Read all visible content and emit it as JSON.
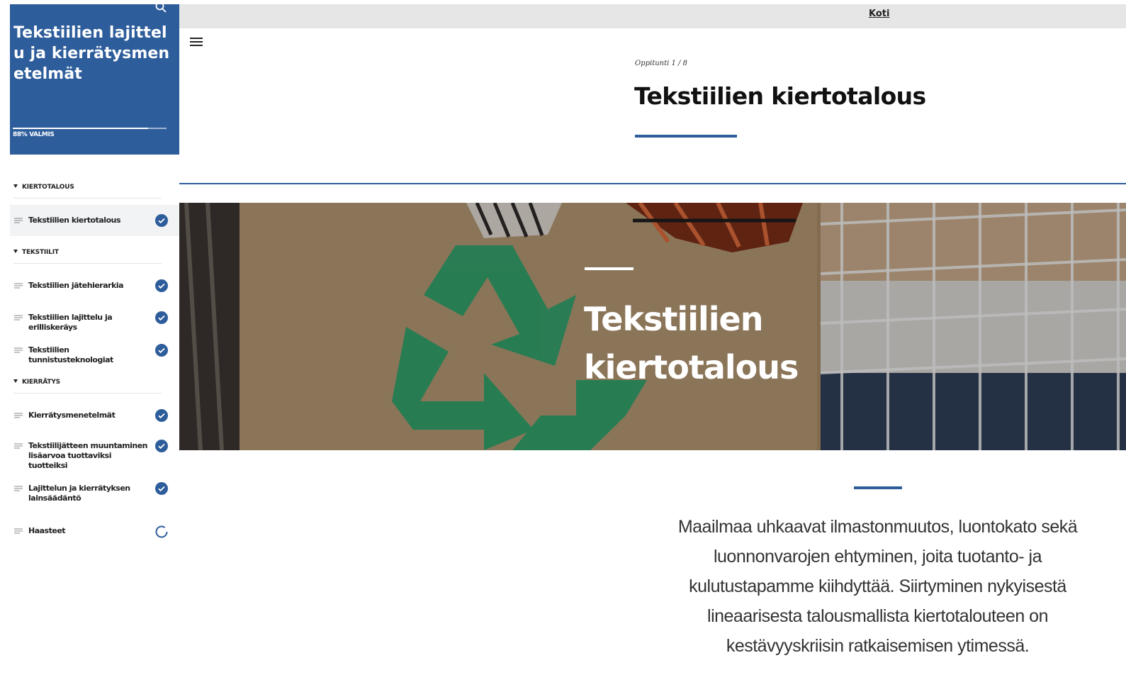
{
  "sidebar": {
    "course_title": "Tekstiilien lajittelu ja kierrätysmenetelmät",
    "progress_label": "88% VALMIS",
    "progress_fraction": 0.88,
    "search_icon": "search-icon",
    "sections": [
      {
        "title": "KIERTOTALOUS",
        "lessons": [
          {
            "label": "Tekstiilien kiertotalous",
            "status": "complete",
            "active": true
          }
        ]
      },
      {
        "title": "TEKSTIILIT",
        "lessons": [
          {
            "label": "Tekstiilien jätehierarkia",
            "status": "complete"
          },
          {
            "label": "Tekstiilien lajittelu ja erilliskeräys",
            "status": "complete"
          },
          {
            "label": "Tekstiilien tunnistusteknologiat",
            "status": "complete"
          }
        ]
      },
      {
        "title": "KIERRÄTYS",
        "lessons": [
          {
            "label": "Kierrätysmenetelmät",
            "status": "complete"
          },
          {
            "label": "Tekstiilijätteen muuntaminen lisäarvoa tuottaviksi tuotteiksi",
            "status": "complete"
          },
          {
            "label": "Lajittelun ja kierrätyksen lainsäädäntö",
            "status": "complete"
          },
          {
            "label": "Haasteet",
            "status": "in-progress"
          }
        ]
      }
    ]
  },
  "topbar": {
    "home_label": "Koti",
    "menu_icon": "hamburger-menu-icon"
  },
  "lesson": {
    "counter": "Oppitunti 1 / 8",
    "title": "Tekstiilien kiertotalous",
    "hero_title": "Tekstiilien kiertotalous",
    "intro": "Maailmaa uhkaavat ilmastonmuutos, luontokato sekä luonnonvarojen ehtyminen, joita tuotanto- ja kulutustapamme kiihdyttää. Siirtyminen nykyisestä lineaarisesta talousmallista kiertotalouteen on kestävyyskriisin ratkaisemisen ytimessä."
  },
  "colors": {
    "accent": "#2e5d9b",
    "check": "#2e5d9b",
    "recycle_green": "#2aa06a"
  }
}
